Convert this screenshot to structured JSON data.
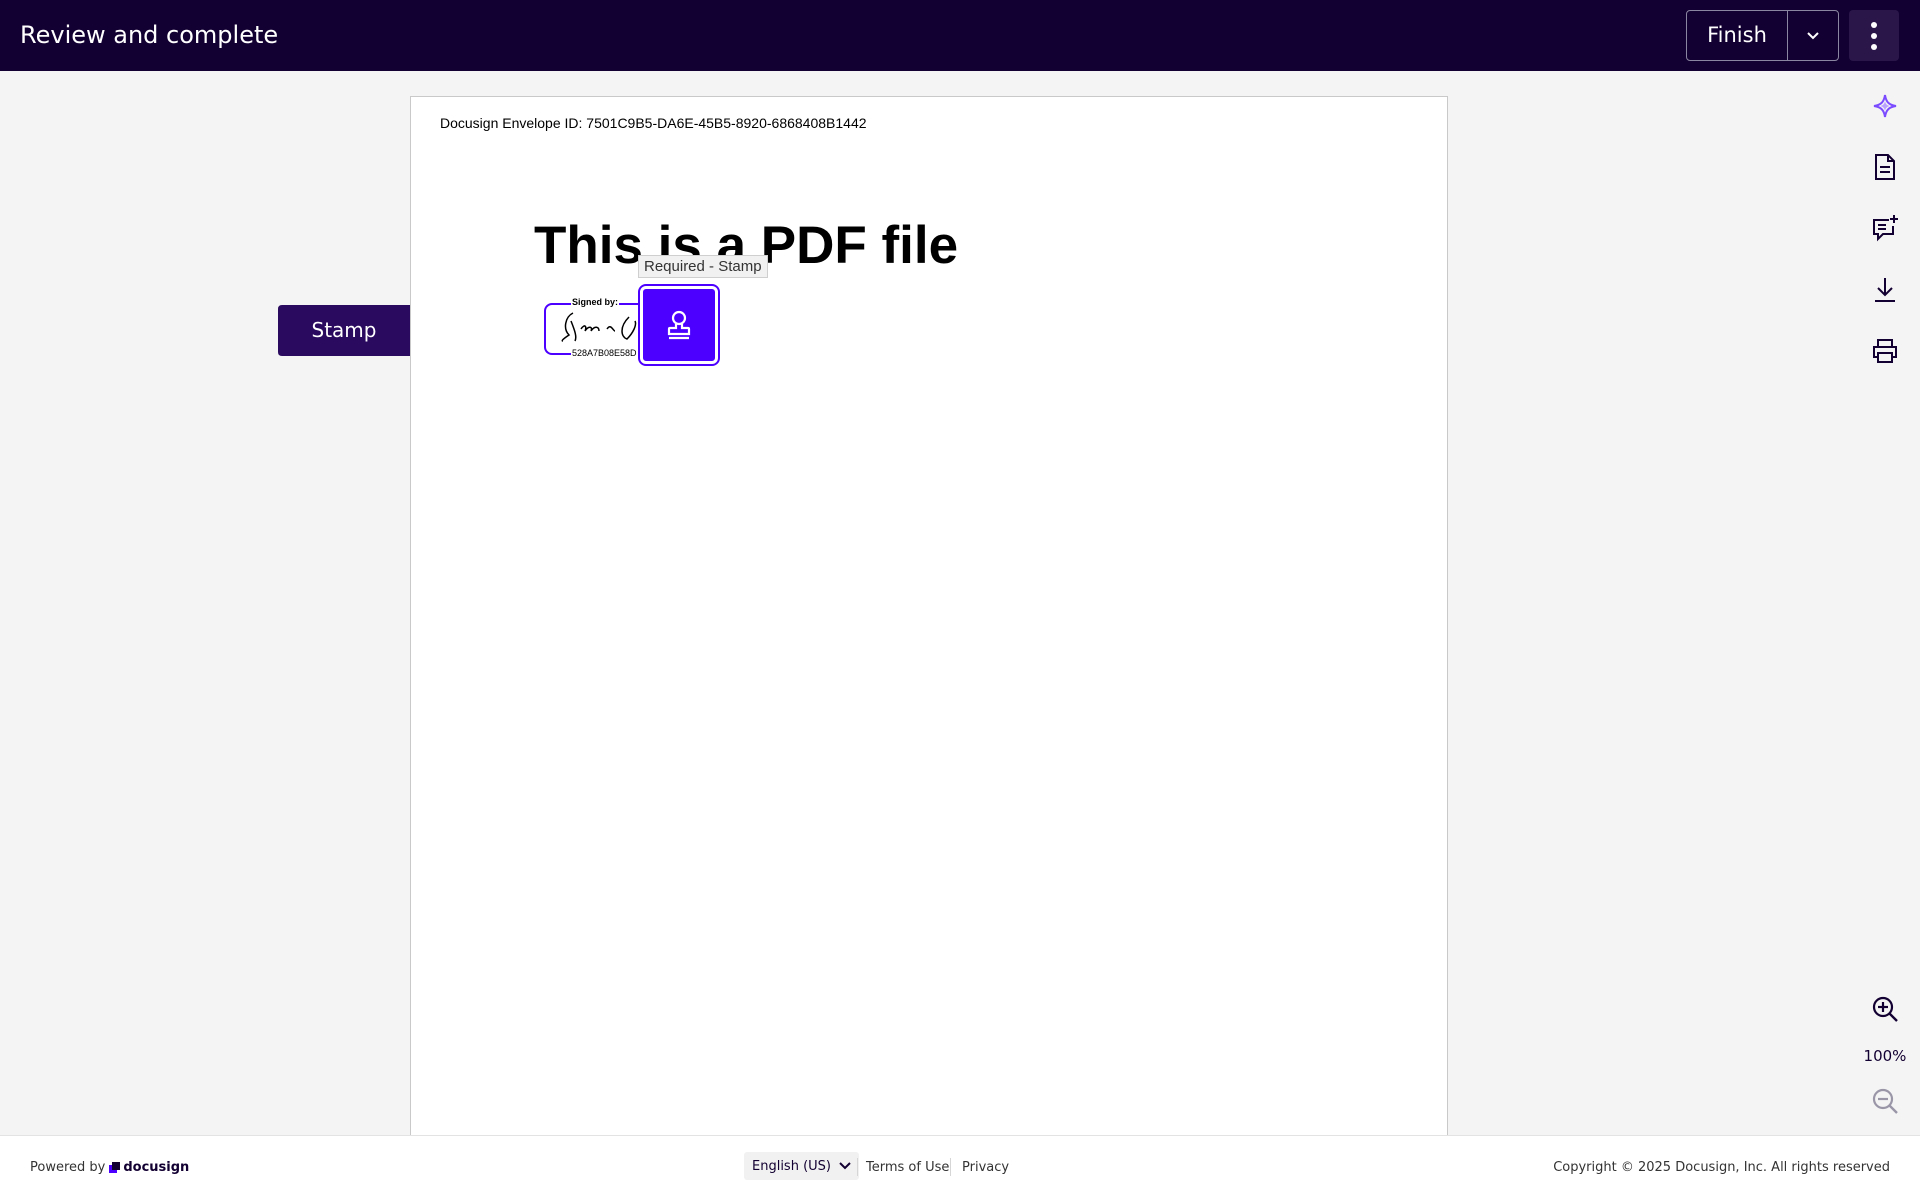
{
  "header": {
    "title": "Review and complete",
    "finish_label": "Finish"
  },
  "document": {
    "envelope_id": "Docusign Envelope ID: 7501C9B5-DA6E-45B5-8920-6868408B1442",
    "title": "This is a PDF file",
    "signature": {
      "signed_by": "Signed by:",
      "signer_id": "528A7B08E58D"
    },
    "stamp_tooltip": "Required - Stamp"
  },
  "stamp_tag": {
    "label": "Stamp"
  },
  "rail": {
    "zoom_level": "100%"
  },
  "footer": {
    "powered_by": "Powered by",
    "brand": "docusign",
    "language": "English (US)",
    "terms": "Terms of Use",
    "privacy": "Privacy",
    "copyright": "Copyright © 2025 Docusign, Inc. All rights reserved"
  },
  "colors": {
    "header_bg": "#130032",
    "accent": "#4c00ff",
    "ai_icon": "#7b4cff"
  }
}
